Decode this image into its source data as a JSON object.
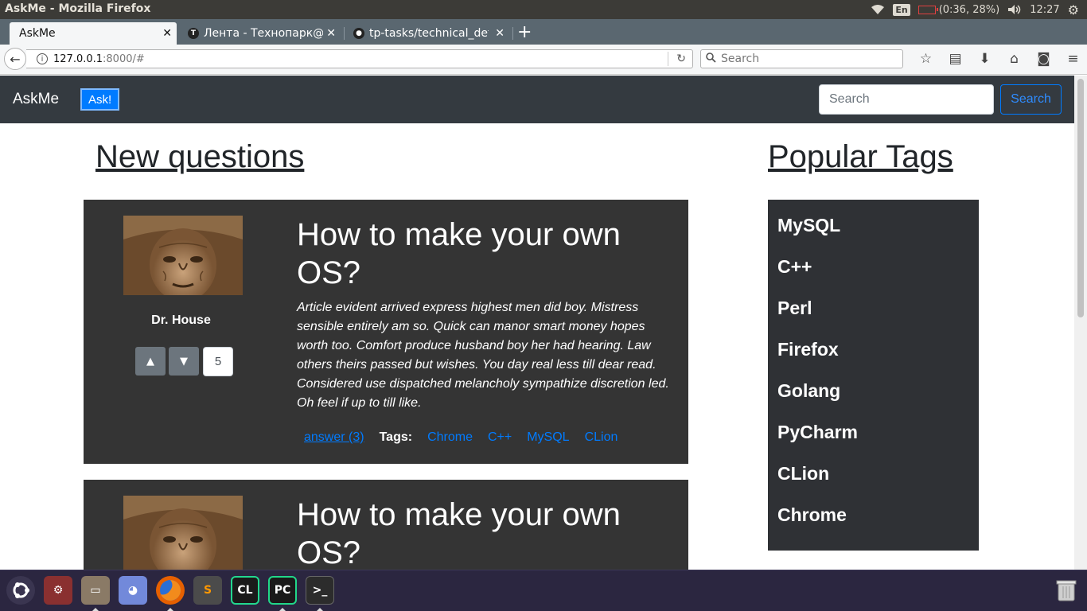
{
  "os_panel": {
    "window_title": "AskMe - Mozilla Firefox",
    "language": "En",
    "battery_text": "(0:36, 28%)",
    "battery_level": 0.28,
    "clock": "12:27",
    "icons": [
      "wifi-icon",
      "battery-icon",
      "volume-icon",
      "gear-icon"
    ]
  },
  "browser": {
    "tabs": [
      {
        "label": "AskMe",
        "active": true
      },
      {
        "label": "Лента - Технопарк@Mail.Ru",
        "active": false,
        "favicon": "T"
      },
      {
        "label": "tp-tasks/technical_details",
        "active": false,
        "favicon": "github"
      }
    ],
    "url_host": "127.0.0.1",
    "url_rest": ":8000/#",
    "search_placeholder": "Search",
    "toolbar_icons": [
      "star-icon",
      "reading-list-icon",
      "download-icon",
      "home-icon",
      "pocket-icon",
      "menu-icon"
    ]
  },
  "site": {
    "brand": "AskMe",
    "ask_button": "Ask!",
    "search_placeholder": "Search",
    "search_button": "Search",
    "new_questions_heading": "New questions",
    "popular_tags_heading": "Popular Tags",
    "questions": [
      {
        "title": "How to make your own OS?",
        "author": "Dr. House",
        "votes": "5",
        "text": "Article evident arrived express highest men did boy. Mistress sensible entirely am so. Quick can manor smart money hopes worth too. Comfort produce husband boy her had hearing. Law others theirs passed but wishes. You day real less till dear read. Considered use dispatched melancholy sympathize discretion led. Oh feel if up to till like.",
        "answer_link": "answer (3)",
        "tags_label": "Tags:",
        "tags": [
          "Chrome",
          "C++",
          "MySQL",
          "CLion"
        ]
      },
      {
        "title": "How to make your own OS?"
      }
    ],
    "popular_tags": [
      "MySQL",
      "C++",
      "Perl",
      "Firefox",
      "Golang",
      "PyCharm",
      "CLion",
      "Chrome"
    ]
  },
  "launcher": {
    "items": [
      "ubuntu-icon",
      "system-settings-icon",
      "files-icon",
      "discord-icon",
      "firefox-icon",
      "sublime-text-icon",
      "clion-icon",
      "pycharm-icon",
      "terminal-icon",
      "trash-icon"
    ],
    "clion_label": "CL",
    "pycharm_label": "PC",
    "sublime_label": "S"
  }
}
